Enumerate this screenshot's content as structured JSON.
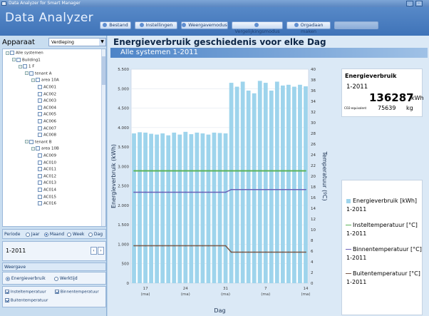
{
  "window": {
    "title": "Data Analyzer for Smart Manager"
  },
  "app": {
    "title": "Data Analyzer"
  },
  "toolbar": [
    {
      "label": "Bestand",
      "active": false
    },
    {
      "label": "Instellingen",
      "active": false
    },
    {
      "label": "Weergavemodus",
      "active": false
    },
    {
      "label": "Vergelijkingsmodus",
      "active": false
    },
    {
      "label": "Orgadaan maken",
      "active": false
    },
    {
      "label": "",
      "active": false
    }
  ],
  "sidebar": {
    "apparaat_label": "Apparaat",
    "view_select": "Verdieping",
    "tree": [
      {
        "label": "Alle systemen",
        "depth": 0
      },
      {
        "label": "Building1",
        "depth": 1
      },
      {
        "label": "1 F",
        "depth": 2
      },
      {
        "label": "tenant A",
        "depth": 3
      },
      {
        "label": "area 10A",
        "depth": 4
      },
      {
        "label": "AC001",
        "depth": 5
      },
      {
        "label": "AC002",
        "depth": 5
      },
      {
        "label": "AC003",
        "depth": 5
      },
      {
        "label": "AC004",
        "depth": 5
      },
      {
        "label": "AC005",
        "depth": 5
      },
      {
        "label": "AC006",
        "depth": 5
      },
      {
        "label": "AC007",
        "depth": 5
      },
      {
        "label": "AC008",
        "depth": 5
      },
      {
        "label": "tenant B",
        "depth": 3
      },
      {
        "label": "area 10B",
        "depth": 4
      },
      {
        "label": "AC009",
        "depth": 5
      },
      {
        "label": "AC010",
        "depth": 5
      },
      {
        "label": "AC011",
        "depth": 5
      },
      {
        "label": "AC012",
        "depth": 5
      },
      {
        "label": "AC013",
        "depth": 5
      },
      {
        "label": "AC014",
        "depth": 5
      },
      {
        "label": "AC015",
        "depth": 5
      },
      {
        "label": "AC016",
        "depth": 5
      }
    ],
    "periode_label": "Periode",
    "periode_options": [
      "Jaar",
      "Maand",
      "Week",
      "Dag"
    ],
    "periode_selected": "Maand",
    "period_value": "1-2011",
    "weergave_label": "Weergave",
    "weergave_options": [
      "Energieverbruik",
      "Werktijd"
    ],
    "weergave_selected": "Energieverbruik",
    "checkboxes": [
      {
        "label": "Insteltemperatuur",
        "checked": true
      },
      {
        "label": "Binnentemperatuur",
        "checked": true
      },
      {
        "label": "Buitentemperatuur",
        "checked": true
      }
    ]
  },
  "main": {
    "title": "Energieverbruik geschiedenis voor elke Dag",
    "subtitle": "Alle systemen  1-2011"
  },
  "info": {
    "title": "Energieverbruik",
    "period": "1-2011",
    "value": "136287",
    "unit": "kWh",
    "co2_label": "CO2-equivalent",
    "co2_value": "75639",
    "co2_unit": "kg"
  },
  "legend": [
    {
      "label": "Energieverbruik [kWh]",
      "period": "1-2011",
      "color": "#9ed4ec",
      "kind": "bar"
    },
    {
      "label": "Insteltemperatuur [°C]",
      "period": "1-2011",
      "color": "#5bb35b",
      "kind": "line"
    },
    {
      "label": "Binnentemperatuur [°C]",
      "period": "1-2011",
      "color": "#6a62b8",
      "kind": "line"
    },
    {
      "label": "Buitentemperatuur [°C]",
      "period": "1-2011",
      "color": "#7a5a4a",
      "kind": "line"
    }
  ],
  "chart_data": {
    "type": "bar",
    "title": "",
    "xlabel": "Dag",
    "ylabel": "Energieverbruik (kWh)",
    "y2label": "Temperatuur (ºC)",
    "ylim": [
      0,
      5500
    ],
    "y2lim": [
      0,
      40
    ],
    "yticks": [
      "0",
      "500",
      "1.000",
      "1.500",
      "2.000",
      "2.500",
      "3.000",
      "3.500",
      "4.000",
      "4.500",
      "5.000",
      "5.500"
    ],
    "y2ticks": [
      "0",
      "2",
      "4",
      "6",
      "8",
      "10",
      "12",
      "14",
      "16",
      "18",
      "20",
      "22",
      "24",
      "26",
      "28",
      "30",
      "32",
      "34",
      "36",
      "38",
      "40"
    ],
    "xticks": [
      {
        "top": "17",
        "bottom": "(ma)",
        "index": 2
      },
      {
        "top": "24",
        "bottom": "(ma)",
        "index": 9
      },
      {
        "top": "31",
        "bottom": "(ma)",
        "index": 16
      },
      {
        "top": "7",
        "bottom": "(ma)",
        "index": 23
      },
      {
        "top": "14",
        "bottom": "(ma)",
        "index": 30
      }
    ],
    "grid": true,
    "bar_color": "#9ed4ec",
    "values": [
      3850,
      3880,
      3870,
      3840,
      3820,
      3850,
      3800,
      3870,
      3820,
      3890,
      3830,
      3870,
      3850,
      3820,
      3870,
      3860,
      3850,
      5150,
      5050,
      5180,
      4950,
      4880,
      5200,
      5150,
      4950,
      5180,
      5080,
      5100,
      5050,
      5100,
      5060
    ],
    "series": [
      {
        "name": "Insteltemperatuur",
        "color": "#5bb35b",
        "axis": "right",
        "values": [
          21,
          21,
          21,
          21,
          21,
          21,
          21,
          21,
          21,
          21,
          21,
          21,
          21,
          21,
          21,
          21,
          21,
          21,
          21,
          21,
          21,
          21,
          21,
          21,
          21,
          21,
          21,
          21,
          21,
          21,
          21
        ]
      },
      {
        "name": "Binnentemperatuur",
        "color": "#6a62b8",
        "axis": "right",
        "values": [
          17,
          17,
          17,
          17,
          17,
          17,
          17,
          17,
          17,
          17,
          17,
          17,
          17,
          17,
          17,
          17,
          17,
          17.5,
          17.5,
          17.5,
          17.5,
          17.5,
          17.5,
          17.5,
          17.5,
          17.5,
          17.5,
          17.5,
          17.5,
          17.5,
          17.5
        ]
      },
      {
        "name": "Buitentemperatuur",
        "color": "#7a5a4a",
        "axis": "right",
        "values": [
          7,
          7,
          7,
          7,
          7,
          7,
          7,
          7,
          7,
          7,
          7,
          7,
          7,
          7,
          7,
          7,
          7,
          5.8,
          5.8,
          5.8,
          5.8,
          5.8,
          5.8,
          5.8,
          5.8,
          5.8,
          5.8,
          5.8,
          5.8,
          5.8,
          5.8
        ]
      }
    ]
  }
}
